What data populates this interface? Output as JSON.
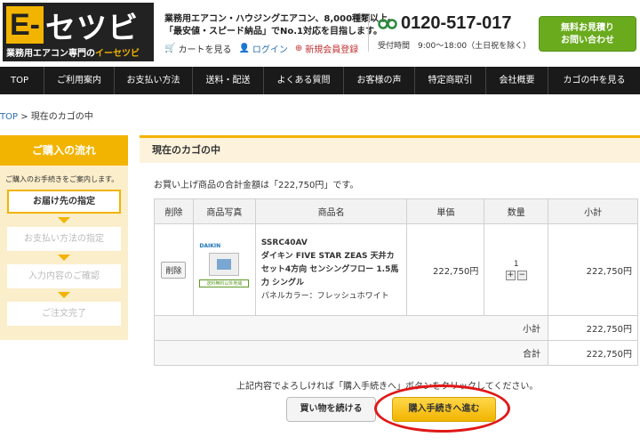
{
  "header": {
    "logo_main": "セツビ",
    "logo_e": "E-",
    "logo_sub_1": "業務用エアコン専門の",
    "logo_sub_2": "イーセツビ",
    "tagline_1": "業務用エアコン・ハウジングエアコン、8,000種類以上。",
    "tagline_2": "「最安値・スピード納品」でNo.1対応を目指します。",
    "cart_link": "カートを見る",
    "login_link": "ログイン",
    "register_link": "新規会員登録",
    "phone": "0120-517-017",
    "hours": "受付時間　9:00～18:00（土日祝を除く）",
    "contact_line1": "無料お見積り",
    "contact_line2": "お問い合わせ"
  },
  "nav": [
    "TOP",
    "ご利用案内",
    "お支払い方法",
    "送料・配送",
    "よくある質問",
    "お客様の声",
    "特定商取引",
    "会社概要",
    "カゴの中を見る"
  ],
  "breadcrumb": {
    "home": "TOP",
    "separator": " > ",
    "current": "現在のカゴの中"
  },
  "sidebar": {
    "title": "ご購入の流れ",
    "intro": "ご購入のお手続きをご案内します。",
    "steps": [
      "お届け先の指定",
      "お支払い方法の指定",
      "入力内容のご確認",
      "ご注文完了"
    ]
  },
  "main": {
    "title": "現在のカゴの中",
    "total_text": "お買い上げ商品の合計金額は「222,750円」です。",
    "columns": [
      "削除",
      "商品写真",
      "商品名",
      "単価",
      "数量",
      "小計"
    ],
    "item": {
      "delete_label": "削除",
      "brand": "DAIKIN",
      "image_badge": "送料無料以外地域",
      "code": "SSRC40AV",
      "title": "ダイキン FIVE STAR ZEAS 天井カセット4方向 センシングフロー 1.5馬力 シングル",
      "color": "パネルカラー：フレッシュホワイト",
      "unit_price": "222,750円",
      "qty": "1",
      "subtotal": "222,750円"
    },
    "subtotal_label": "小計",
    "subtotal_value": "222,750円",
    "total_label": "合計",
    "total_value": "222,750円",
    "footnote": "上記内容でよろしければ「購入手続きへ」ボタンをクリックしてください。",
    "back_button": "買い物を続ける",
    "proceed_button": "購入手続きへ進む"
  },
  "colors": {
    "accent": "#f2b400",
    "nav": "#1a1a1a",
    "highlight_ring": "#e01818",
    "contact": "#6aab1e"
  }
}
